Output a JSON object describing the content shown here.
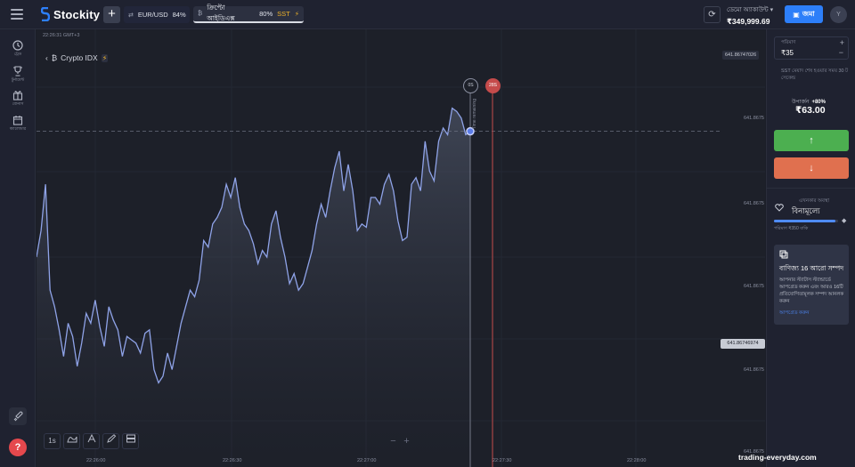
{
  "header": {
    "brand": "Stockity",
    "add_label": "+",
    "tabs": [
      {
        "name": "EUR/USD",
        "payout": "84%"
      },
      {
        "name": "ক্রিপ্টো আইডিএক্স",
        "payout": "80%",
        "badge": "SST"
      }
    ],
    "account_type": "ডেমো অ্যাকাউন্ট",
    "balance": "₹349,999.69",
    "deposit_label": "জমা",
    "avatar": "Y"
  },
  "sidebar": {
    "items": [
      {
        "icon": "clock-icon",
        "label": "ট্রেড"
      },
      {
        "icon": "trophy-icon",
        "label": "টুর্নামেন্ট"
      },
      {
        "icon": "gift-icon",
        "label": "বোনাস"
      },
      {
        "icon": "calendar-icon",
        "label": "ক্যালেন্ডার"
      }
    ],
    "help_label": "?"
  },
  "chart": {
    "clock": "22:26:31 GMT+3",
    "asset": "Crypto IDX",
    "top_price": "641.86747026",
    "current_price": "641.86746974",
    "timer_start": "0S",
    "timer_end": "28S",
    "time_remaining": "Time remaining",
    "tools": [
      "1s"
    ],
    "zoom_out": "−",
    "zoom_in": "+"
  },
  "chart_data": {
    "type": "area",
    "title": "",
    "xlabel": "",
    "ylabel": "",
    "x_ticks": [
      "22:26:00",
      "22:26:30",
      "22:27:00",
      "22:27:30",
      "22:28:00"
    ],
    "y_ticks": [
      "641.8675",
      "641.8675",
      "641.8675",
      "641.8675",
      "641.8675"
    ],
    "current_value": 641.86746974,
    "series": [
      {
        "values": [
          50,
          58,
          72,
          40,
          35,
          28,
          20,
          30,
          26,
          17,
          24,
          33,
          30,
          37,
          29,
          23,
          35,
          31,
          28,
          20,
          26,
          25,
          24,
          21,
          27,
          28,
          16,
          12,
          14,
          21,
          16,
          23,
          30,
          35,
          40,
          38,
          43,
          55,
          53,
          60,
          62,
          65,
          72,
          68,
          74,
          65,
          60,
          58,
          54,
          48,
          52,
          50,
          60,
          64,
          56,
          50,
          42,
          45,
          40,
          42,
          47,
          52,
          60,
          66,
          62,
          70,
          77,
          82,
          70,
          78,
          70,
          58,
          60,
          59,
          68,
          68,
          66,
          72,
          75,
          70,
          61,
          55,
          56,
          72,
          74,
          70,
          85,
          76,
          73,
          85,
          89,
          87,
          95,
          94,
          92,
          87,
          88
        ]
      }
    ]
  },
  "panel": {
    "amount_label": "পরিমাণ",
    "amount": "₹35",
    "expiry_note": "SST মেয়াদ শেষ হওয়ার সময় 30 ট সেকেন্ড",
    "payout_label": "উপার্জন",
    "payout_pct": "+80%",
    "payout_value": "₹63.00",
    "status_caption": "এখনকার অবস্থা",
    "status_name": "বিনামূল্যে",
    "status_progress": 0.96,
    "status_note": "পরিমাণ ₹350 বাকি",
    "promo_title": "বাণিজ্য 16 আরো সম্পদ",
    "promo_desc": "আপনার স্ট্যাটাস স্ট্যান্ডার্ডে আপগ্রেড করুন এবং আরও 16টি প্রতিযোগিতামূলক সম্পদ আনলক করুন",
    "promo_link": "আপগ্রেড করুন"
  },
  "footer": {
    "watermark": "trading-everyday.com"
  },
  "colors": {
    "up": "#4caf50",
    "down": "#e0704f",
    "accent": "#2d7ff9",
    "line": "#8fa3e8"
  }
}
